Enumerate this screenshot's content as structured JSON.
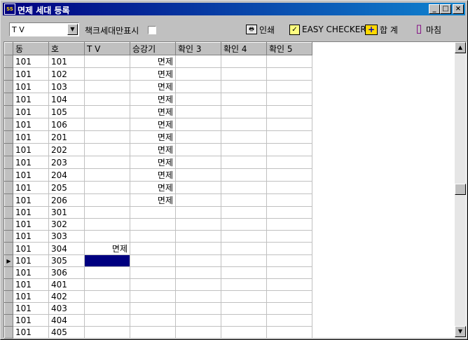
{
  "window": {
    "title": "면제 세대 등록",
    "icon_text": "SS",
    "minimize_glyph": "_",
    "maximize_glyph": "□",
    "close_glyph": "×"
  },
  "toolbar": {
    "combo_value": "T V",
    "combo_arrow": "▼",
    "checkbox_label": "책크세대만표시",
    "buttons": [
      {
        "label": "인쇄",
        "icon": "printer-icon",
        "glyph": "🖶"
      },
      {
        "label": "EASY CHECKER",
        "icon": "checklist-icon",
        "glyph": "✓"
      },
      {
        "label": "합 계",
        "icon": "sum-icon",
        "glyph": "+"
      },
      {
        "label": "마침",
        "icon": "exit-door-icon",
        "glyph": "▯"
      }
    ]
  },
  "grid": {
    "columns": [
      "동",
      "호",
      "T V",
      "승강기",
      "확인 3",
      "확인 4",
      "확인 5"
    ],
    "current_row_marker": "▶",
    "rows": [
      {
        "dong": "101",
        "ho": "101",
        "tv": "",
        "elev": "면제"
      },
      {
        "dong": "101",
        "ho": "102",
        "tv": "",
        "elev": "면제"
      },
      {
        "dong": "101",
        "ho": "103",
        "tv": "",
        "elev": "면제"
      },
      {
        "dong": "101",
        "ho": "104",
        "tv": "",
        "elev": "면제"
      },
      {
        "dong": "101",
        "ho": "105",
        "tv": "",
        "elev": "면제"
      },
      {
        "dong": "101",
        "ho": "106",
        "tv": "",
        "elev": "면제"
      },
      {
        "dong": "101",
        "ho": "201",
        "tv": "",
        "elev": "면제"
      },
      {
        "dong": "101",
        "ho": "202",
        "tv": "",
        "elev": "면제"
      },
      {
        "dong": "101",
        "ho": "203",
        "tv": "",
        "elev": "면제"
      },
      {
        "dong": "101",
        "ho": "204",
        "tv": "",
        "elev": "면제"
      },
      {
        "dong": "101",
        "ho": "205",
        "tv": "",
        "elev": "면제"
      },
      {
        "dong": "101",
        "ho": "206",
        "tv": "",
        "elev": "면제"
      },
      {
        "dong": "101",
        "ho": "301",
        "tv": "",
        "elev": ""
      },
      {
        "dong": "101",
        "ho": "302",
        "tv": "",
        "elev": ""
      },
      {
        "dong": "101",
        "ho": "303",
        "tv": "",
        "elev": ""
      },
      {
        "dong": "101",
        "ho": "304",
        "tv": "면제",
        "elev": ""
      },
      {
        "dong": "101",
        "ho": "305",
        "tv": "",
        "elev": "",
        "current": true
      },
      {
        "dong": "101",
        "ho": "306",
        "tv": "",
        "elev": ""
      },
      {
        "dong": "101",
        "ho": "401",
        "tv": "",
        "elev": ""
      },
      {
        "dong": "101",
        "ho": "402",
        "tv": "",
        "elev": ""
      },
      {
        "dong": "101",
        "ho": "403",
        "tv": "",
        "elev": ""
      },
      {
        "dong": "101",
        "ho": "404",
        "tv": "",
        "elev": ""
      },
      {
        "dong": "101",
        "ho": "405",
        "tv": "",
        "elev": ""
      }
    ]
  },
  "scrollbar": {
    "up_glyph": "▲",
    "down_glyph": "▼"
  }
}
